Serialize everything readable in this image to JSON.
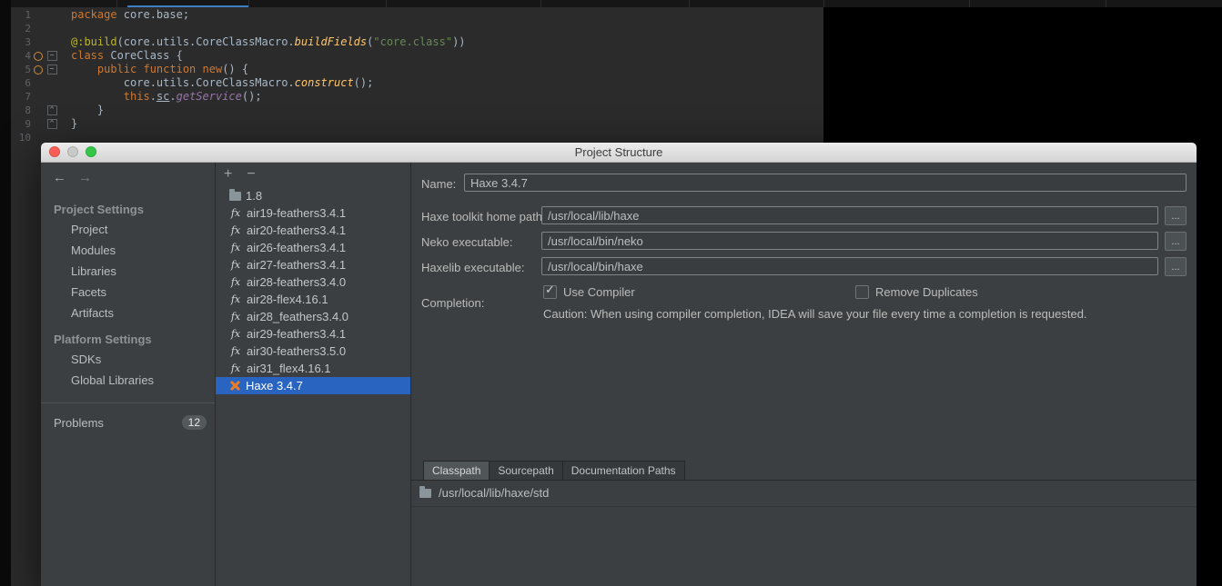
{
  "editor": {
    "line_numbers": [
      "1",
      "2",
      "3",
      "4",
      "5",
      "6",
      "7",
      "8",
      "9",
      "10"
    ],
    "gutter_rows": [
      {
        "n": "1"
      },
      {
        "n": "2"
      },
      {
        "n": "3"
      },
      {
        "n": "4",
        "marker": "override-marker-icon",
        "fold": "collapse"
      },
      {
        "n": "5",
        "marker": "override-marker-icon",
        "fold": "collapse"
      },
      {
        "n": "6"
      },
      {
        "n": "7"
      },
      {
        "n": "8",
        "fold": "end"
      },
      {
        "n": "9",
        "fold": "end"
      },
      {
        "n": "10"
      }
    ],
    "lines": [
      [
        {
          "t": "package",
          "c": "kw"
        },
        {
          "t": " core.base;",
          "c": "pl"
        }
      ],
      [],
      [
        {
          "t": "@:build",
          "c": "meta"
        },
        {
          "t": "(core.utils.CoreClassMacro.",
          "c": "pl"
        },
        {
          "t": "buildFields",
          "c": "method"
        },
        {
          "t": "(",
          "c": "pl"
        },
        {
          "t": "\"core.class\"",
          "c": "str"
        },
        {
          "t": "))",
          "c": "pl"
        }
      ],
      [
        {
          "t": "class ",
          "c": "kw"
        },
        {
          "t": "CoreClass {",
          "c": "pl"
        }
      ],
      [
        {
          "t": "    ",
          "c": "pl"
        },
        {
          "t": "public function ",
          "c": "kw"
        },
        {
          "t": "new",
          "c": "kw"
        },
        {
          "t": "() {",
          "c": "pl"
        }
      ],
      [
        {
          "t": "        core.utils.CoreClassMacro.",
          "c": "pl"
        },
        {
          "t": "construct",
          "c": "method"
        },
        {
          "t": "();",
          "c": "pl"
        }
      ],
      [
        {
          "t": "        ",
          "c": "pl"
        },
        {
          "t": "this",
          "c": "kw"
        },
        {
          "t": ".",
          "c": "pl"
        },
        {
          "t": "sc",
          "c": "ul"
        },
        {
          "t": ".",
          "c": "pl"
        },
        {
          "t": "getService",
          "c": "member"
        },
        {
          "t": "();",
          "c": "pl"
        }
      ],
      [
        {
          "t": "    }",
          "c": "pl"
        }
      ],
      [
        {
          "t": "}",
          "c": "pl"
        }
      ],
      []
    ]
  },
  "icons": {
    "back": "←",
    "forward": "→",
    "add": "+",
    "remove": "−"
  },
  "dialog": {
    "title": "Project Structure",
    "sidebar": {
      "sections": [
        {
          "header": "Project Settings",
          "items": [
            "Project",
            "Modules",
            "Libraries",
            "Facets",
            "Artifacts"
          ]
        },
        {
          "header": "Platform Settings",
          "items": [
            "SDKs",
            "Global Libraries"
          ]
        }
      ],
      "problems": {
        "label": "Problems",
        "badge": "12"
      }
    },
    "sdk_panel": {
      "items": [
        {
          "icon": "folder-icon",
          "label": "1.8"
        },
        {
          "icon": "flex-sdk-icon",
          "label": "air19-feathers3.4.1"
        },
        {
          "icon": "flex-sdk-icon",
          "label": "air20-feathers3.4.1"
        },
        {
          "icon": "flex-sdk-icon",
          "label": "air26-feathers3.4.1"
        },
        {
          "icon": "flex-sdk-icon",
          "label": "air27-feathers3.4.1"
        },
        {
          "icon": "flex-sdk-icon",
          "label": "air28-feathers3.4.0"
        },
        {
          "icon": "flex-sdk-icon",
          "label": "air28-flex4.16.1"
        },
        {
          "icon": "flex-sdk-icon",
          "label": "air28_feathers3.4.0"
        },
        {
          "icon": "flex-sdk-icon",
          "label": "air29-feathers3.4.1"
        },
        {
          "icon": "flex-sdk-icon",
          "label": "air30-feathers3.5.0"
        },
        {
          "icon": "flex-sdk-icon",
          "label": "air31_flex4.16.1"
        },
        {
          "icon": "haxe-icon",
          "label": "Haxe 3.4.7",
          "selected": true
        }
      ]
    },
    "form": {
      "name_label": "Name:",
      "name_value": "Haxe 3.4.7",
      "rows": [
        {
          "field_name": "haxe-toolkit-home-path-field",
          "label": "Haxe toolkit home path:",
          "value": "/usr/local/lib/haxe",
          "browse": "..."
        },
        {
          "field_name": "neko-executable-field",
          "label": "Neko executable:",
          "value": "/usr/local/bin/neko",
          "browse": "..."
        },
        {
          "field_name": "haxelib-executable-field",
          "label": "Haxelib executable:",
          "value": "/usr/local/bin/haxe",
          "browse": "..."
        }
      ],
      "completion_label": "Completion:",
      "use_compiler": {
        "label": "Use Compiler",
        "checked": true
      },
      "remove_duplicates": {
        "label": "Remove Duplicates",
        "checked": false
      },
      "caution": "Caution: When using compiler completion, IDEA will save your file every time a completion is requested."
    },
    "tabs": [
      {
        "label": "Classpath",
        "active": true
      },
      {
        "label": "Sourcepath",
        "active": false
      },
      {
        "label": "Documentation Paths",
        "active": false
      }
    ],
    "classpath_rows": [
      {
        "icon": "folder-icon",
        "path": "/usr/local/lib/haxe/std"
      }
    ]
  }
}
